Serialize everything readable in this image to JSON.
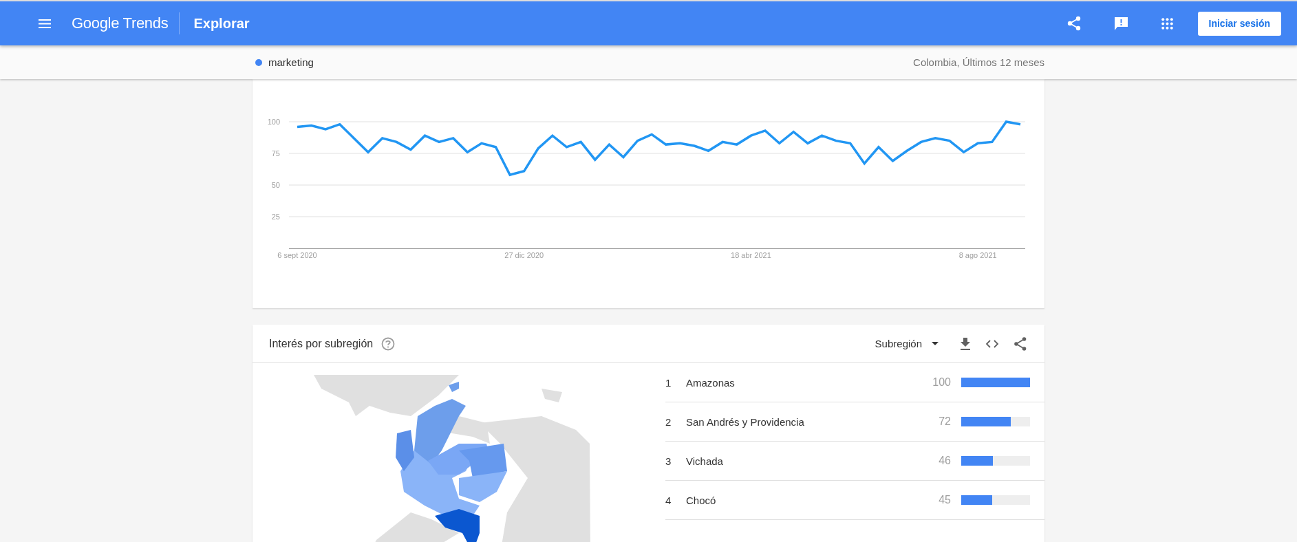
{
  "app_bar": {
    "logo": "Google Trends",
    "page_title": "Explorar",
    "sign_in_button": "Iniciar sesión"
  },
  "comparison_bar": {
    "terms": [
      {
        "label": "marketing",
        "color": "#4285f4"
      }
    ],
    "scope": "Colombia, Últimos 12 meses"
  },
  "interest_over_time": {
    "chart_data": {
      "type": "line",
      "categories": [
        "6 sept 2020",
        null,
        null,
        null,
        null,
        null,
        null,
        null,
        null,
        null,
        null,
        null,
        null,
        null,
        null,
        null,
        "27 dic 2020",
        null,
        null,
        null,
        null,
        null,
        null,
        null,
        null,
        null,
        null,
        null,
        null,
        null,
        null,
        null,
        "18 abr 2021",
        null,
        null,
        null,
        null,
        null,
        null,
        null,
        null,
        null,
        null,
        null,
        null,
        null,
        null,
        null,
        "8 ago 2021",
        null,
        null,
        null
      ],
      "series": [
        {
          "color": "#2196f3",
          "values": [
            96,
            97,
            94,
            98,
            87,
            76,
            87,
            84,
            78,
            89,
            84,
            87,
            76,
            83,
            80,
            58,
            61,
            79,
            89,
            80,
            84,
            70,
            82,
            72,
            85,
            90,
            82,
            83,
            81,
            77,
            84,
            82,
            89,
            93,
            83,
            92,
            83,
            89,
            85,
            83,
            67,
            80,
            69,
            77,
            84,
            87,
            85,
            76,
            83,
            84,
            100,
            98
          ]
        }
      ],
      "ylim": [
        0,
        100
      ],
      "yticks": [
        25,
        50,
        75,
        100
      ],
      "grid": true
    }
  },
  "interest_by_subregion": {
    "title": "Interés por subregión",
    "resolution_dropdown": "Subregión",
    "rows": [
      {
        "rank": "1",
        "name": "Amazonas",
        "value": "100",
        "level": 1
      },
      {
        "rank": "2",
        "name": "San Andrés y Providencia",
        "value": "72",
        "level": 0.72
      },
      {
        "rank": "3",
        "name": "Vichada",
        "value": "46",
        "level": 0.46
      },
      {
        "rank": "4",
        "name": "Chocó",
        "value": "45",
        "level": 0.45
      }
    ]
  }
}
